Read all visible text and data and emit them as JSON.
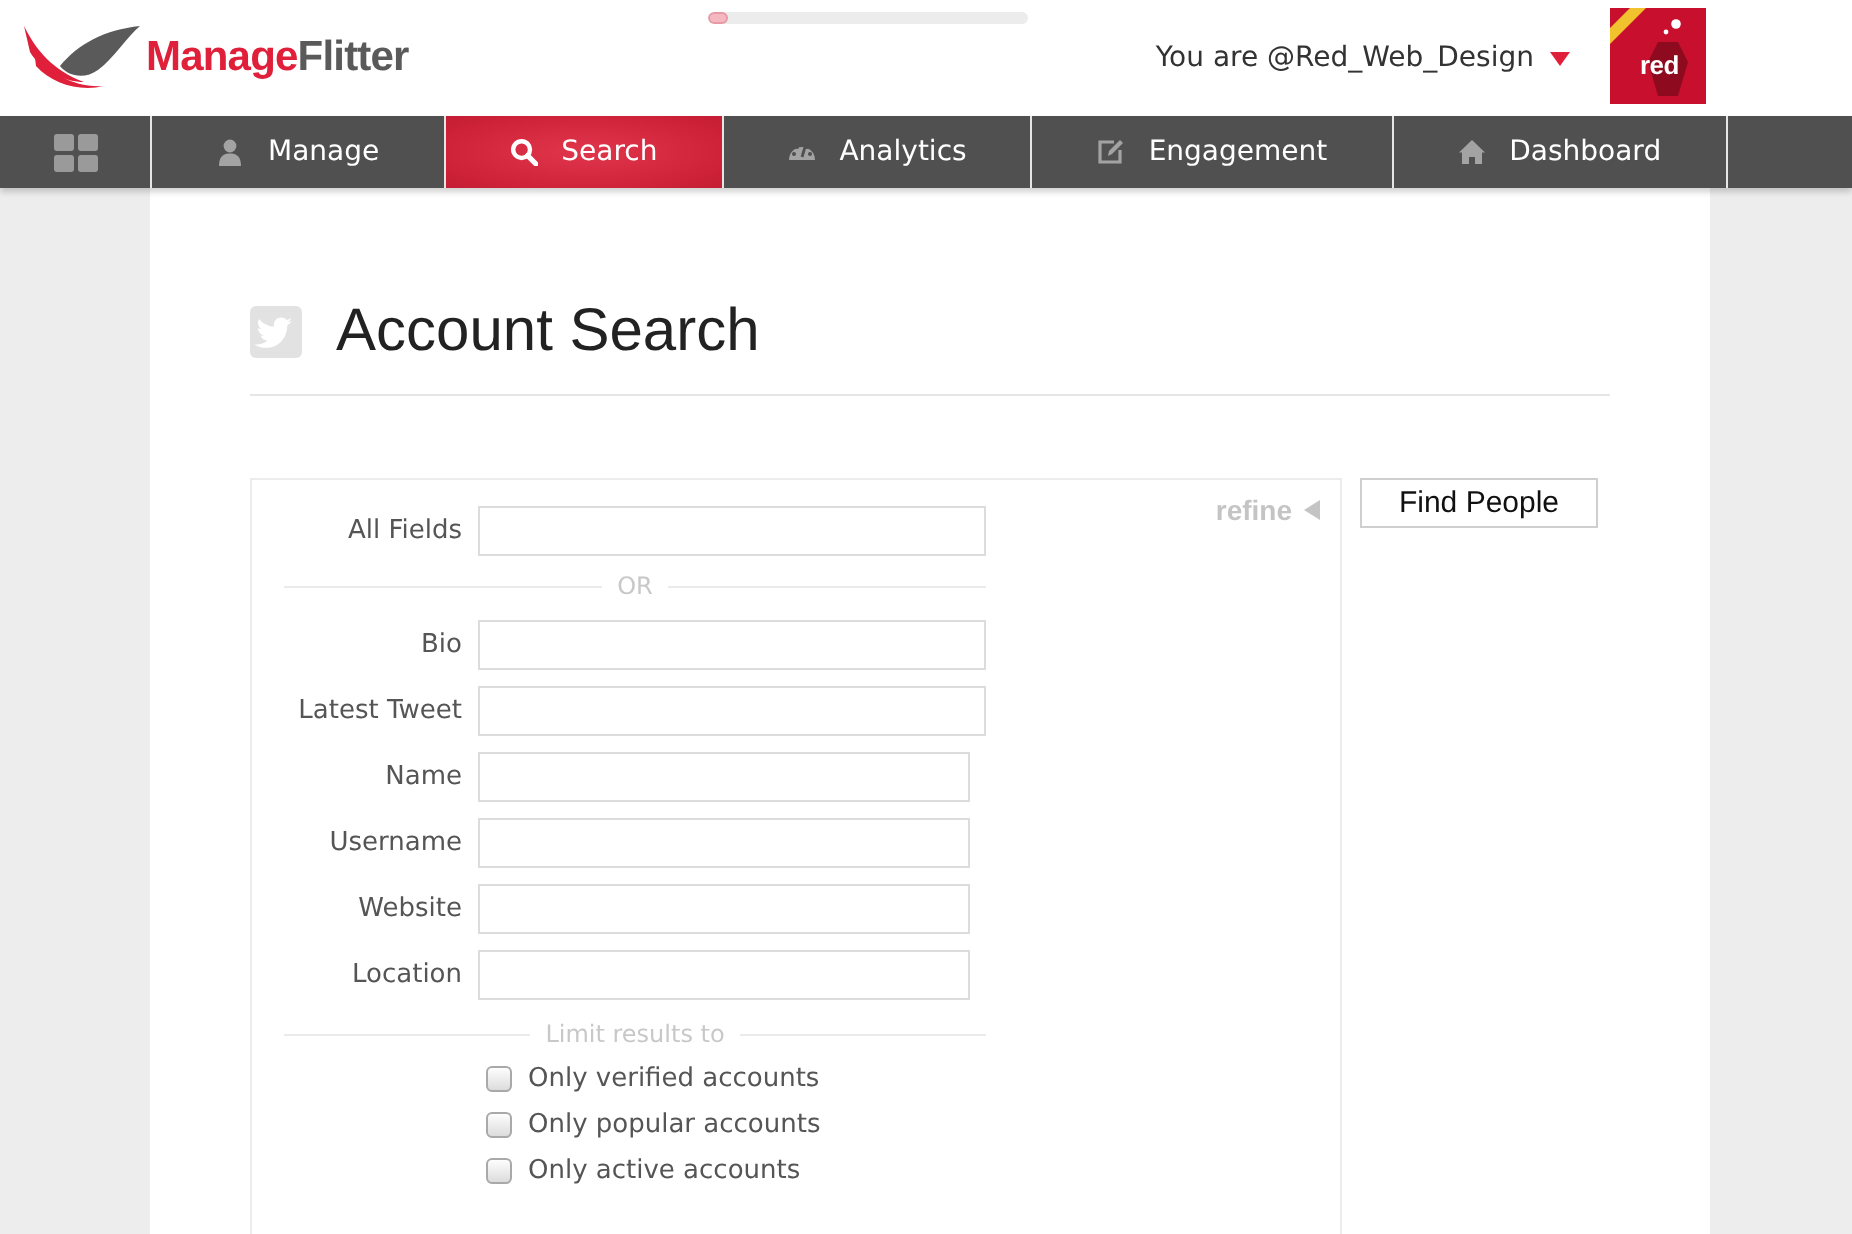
{
  "header": {
    "logo": {
      "parts": [
        {
          "text": "Manage",
          "color": "#e0203a"
        },
        {
          "text": "Flitter",
          "color": "#5a5a5a"
        }
      ]
    },
    "loading_bar": {
      "level": 0.06
    },
    "user": {
      "text": "You are @Red_Web_Design"
    },
    "avatar": {
      "text": "red"
    }
  },
  "nav": {
    "items": [
      {
        "label": "Manage",
        "selected": false
      },
      {
        "label": "Search",
        "selected": true
      },
      {
        "label": "Analytics",
        "selected": false
      },
      {
        "label": "Engagement",
        "selected": false
      },
      {
        "label": "Dashboard",
        "selected": false
      }
    ]
  },
  "page": {
    "title": "Account Search"
  },
  "search_form": {
    "refine": "refine",
    "all_fields": {
      "label": "All Fields"
    },
    "or_divider": "OR",
    "fields": [
      {
        "label": "Bio"
      },
      {
        "label": "Latest Tweet"
      },
      {
        "label": "Name"
      },
      {
        "label": "Username"
      },
      {
        "label": "Website"
      },
      {
        "label": "Location"
      }
    ],
    "limit_divider": "Limit results to",
    "checkboxes": [
      {
        "label": "Only verified accounts",
        "checked": false
      },
      {
        "label": "Only popular accounts",
        "checked": false
      },
      {
        "label": "Only active accounts",
        "checked": false
      }
    ]
  },
  "find_button": {
    "label": "Find People"
  }
}
